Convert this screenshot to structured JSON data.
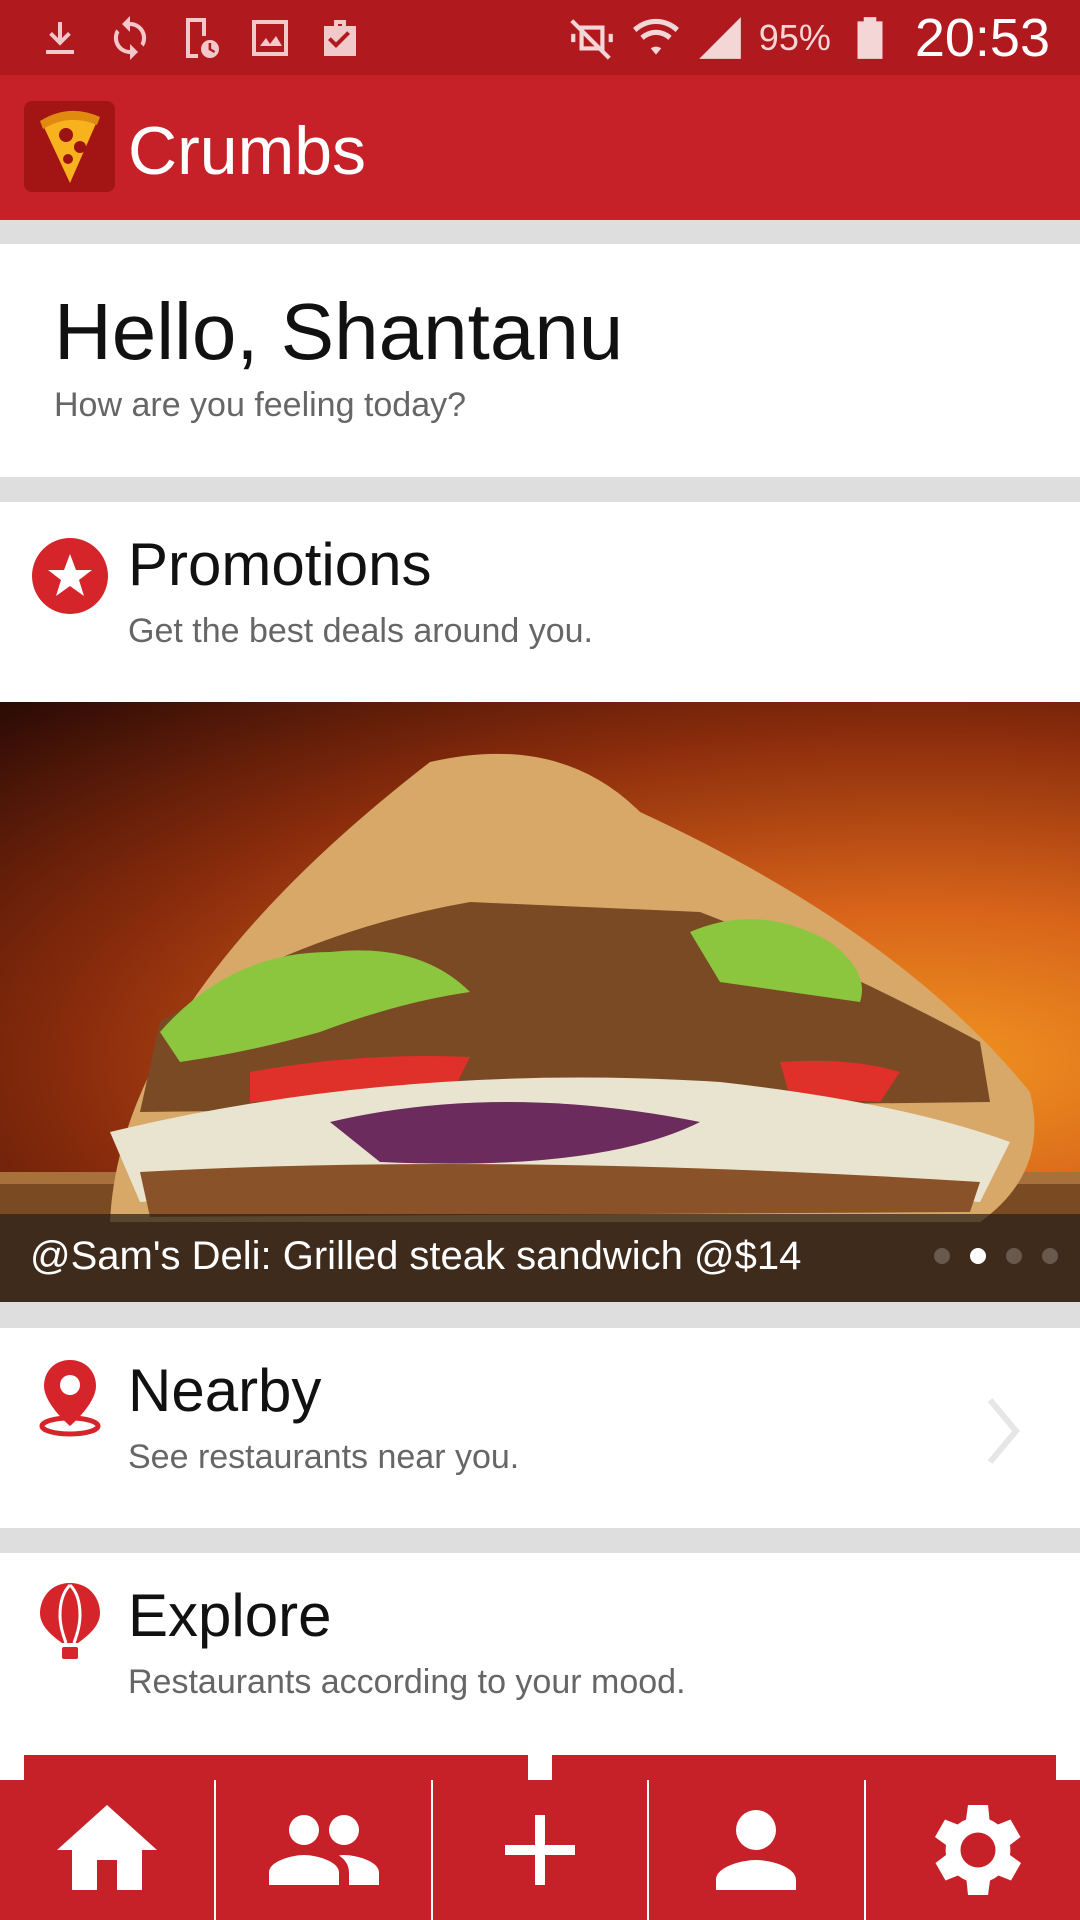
{
  "status_bar": {
    "battery": "95%",
    "time": "20:53",
    "icons_left": [
      "download-icon",
      "sync-icon",
      "device-clock-icon",
      "image-icon",
      "briefcase-check-icon"
    ],
    "icons_right": [
      "vibrate-mute-icon",
      "wifi-icon",
      "signal-icon",
      "battery-icon"
    ]
  },
  "app_bar": {
    "title": "Crumbs",
    "logo_icon": "pizza-slice-icon"
  },
  "greeting": {
    "title": "Hello, Shantanu",
    "subtitle": "How are you feeling today?"
  },
  "promotions": {
    "title": "Promotions",
    "subtitle": "Get the best deals around you.",
    "icon": "star-badge-icon",
    "banner": {
      "caption": "@Sam's Deli: Grilled steak sandwich @$14",
      "slide_count": 4,
      "active_slide": 2
    }
  },
  "nearby": {
    "title": "Nearby",
    "subtitle": "See restaurants near you.",
    "icon": "location-pin-icon"
  },
  "explore": {
    "title": "Explore",
    "subtitle": "Restaurants according to your mood.",
    "icon": "hot-air-balloon-icon"
  },
  "bottom_nav": [
    "home-icon",
    "friends-icon",
    "add-icon",
    "profile-icon",
    "settings-icon"
  ],
  "colors": {
    "brand_red": "#c62128",
    "status_bar": "#b01a1f",
    "background": "#dedede"
  }
}
